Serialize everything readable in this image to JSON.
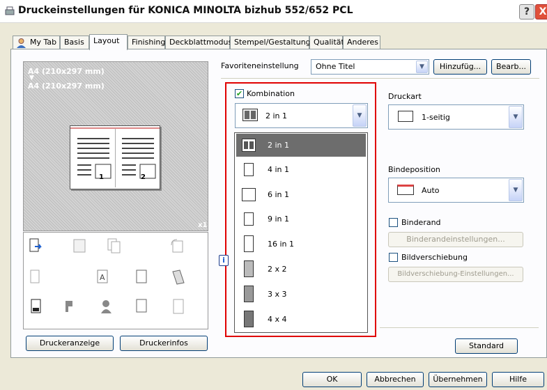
{
  "window": {
    "title": "Druckeinstellungen für KONICA MINOLTA bizhub 552/652 PCL",
    "help_label": "?",
    "close_label": "X"
  },
  "tabs": [
    "My Tab",
    "Basis",
    "Layout",
    "Finishing",
    "Deckblattmodus",
    "Stempel/Gestaltung",
    "Qualität",
    "Anderes"
  ],
  "preview": {
    "paper_top": "A4 (210x297 mm)",
    "arrow": "▼",
    "paper_bottom": "A4 (210x297 mm)",
    "copies": "x1",
    "page_nums": [
      "1",
      "2"
    ]
  },
  "buttons": {
    "printer_view": "Druckeranzeige",
    "printer_info": "Druckerinfos",
    "favorite_add": "Hinzufüg...",
    "favorite_edit": "Bearb...",
    "standard": "Standard",
    "ok": "OK",
    "cancel": "Abbrechen",
    "apply": "Übernehmen",
    "help": "Hilfe",
    "binding_margin_settings": "Binderandeinstellungen...",
    "image_shift_settings": "Bildverschiebung-Einstellungen..."
  },
  "favorite": {
    "label": "Favoriteneinstellung",
    "value": "Ohne Titel"
  },
  "combination": {
    "label": "Kombination",
    "checked": true,
    "value": "2 in 1",
    "options": [
      "2 in 1",
      "4 in 1",
      "6 in 1",
      "9 in 1",
      "16 in 1",
      "2 x 2",
      "3 x 3",
      "4 x 4"
    ],
    "selected_index": 0
  },
  "print_type": {
    "label": "Druckart",
    "value": "1-seitig"
  },
  "binding_position": {
    "label": "Bindeposition",
    "value": "Auto"
  },
  "binding_margin": {
    "label": "Binderand",
    "checked": false
  },
  "image_shift": {
    "label": "Bildverschiebung",
    "checked": false
  },
  "info_badge": "i",
  "colors": {
    "highlight": "#e00000",
    "selected_row": "#6d6d6d",
    "title_close": "#e0503a"
  }
}
